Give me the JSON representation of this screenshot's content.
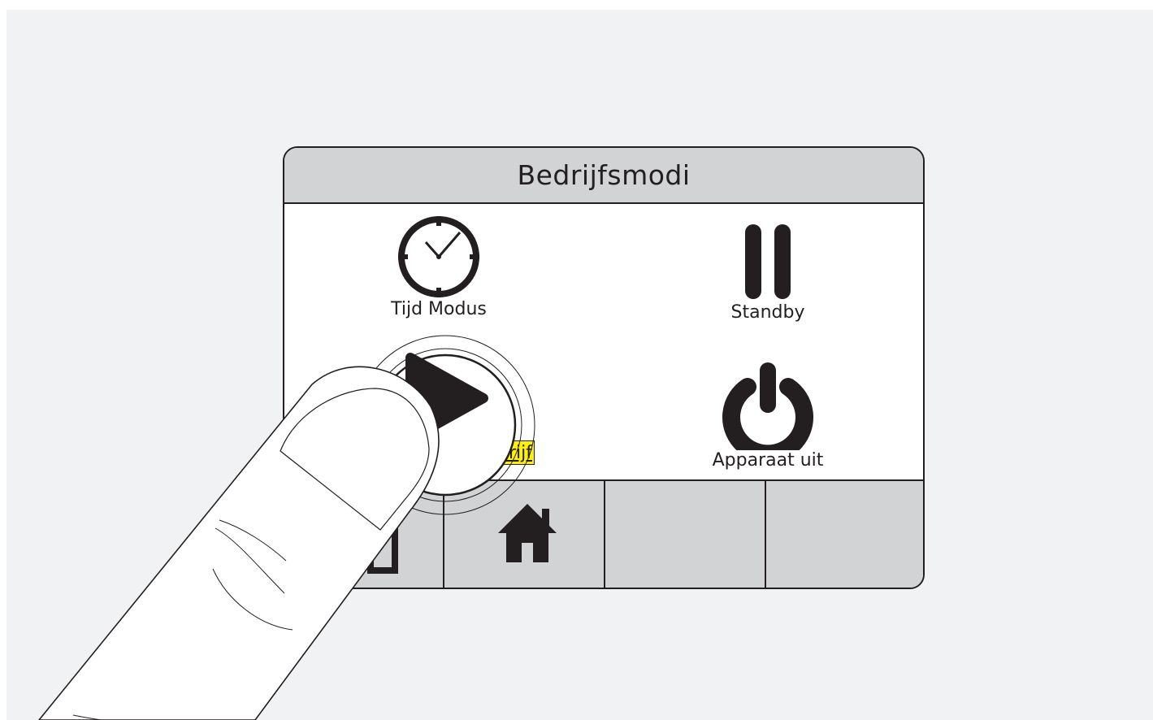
{
  "screen": {
    "title": "Bedrijfsmodi",
    "modes": [
      {
        "label": "Tijd Modus",
        "icon": "clock-icon"
      },
      {
        "label": "Standby",
        "icon": "pause-icon"
      },
      {
        "label": "sch bedrijf",
        "icon": "play-icon",
        "highlighted": true
      },
      {
        "label": "Apparaat uit",
        "icon": "power-icon"
      }
    ],
    "footer_tabs": [
      {
        "icon": "back-icon"
      },
      {
        "icon": "home-icon"
      },
      {
        "icon": ""
      },
      {
        "icon": ""
      }
    ]
  },
  "colors": {
    "background": "#f1f2f4",
    "panel": "#d1d3d4",
    "ink": "#231f20",
    "highlight": "#fff200"
  }
}
